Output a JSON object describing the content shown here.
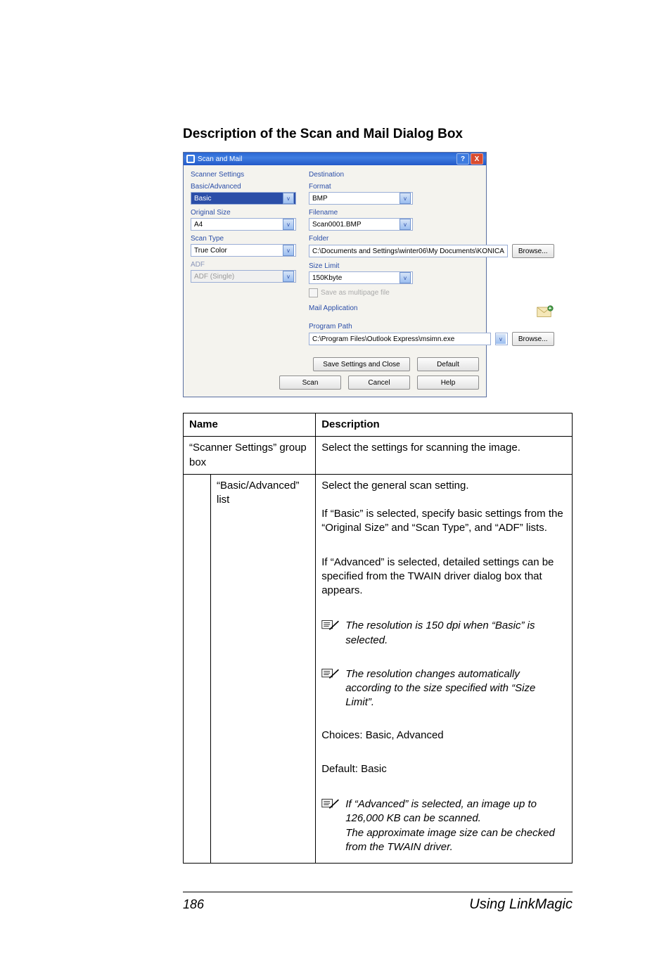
{
  "section_title": "Description of the Scan and Mail Dialog Box",
  "dialog": {
    "title": "Scan and Mail",
    "help_glyph": "?",
    "close_glyph": "X",
    "scanner_settings_title": "Scanner Settings",
    "basic_advanced_label": "Basic/Advanced",
    "basic_advanced_value": "Basic",
    "original_size_label": "Original Size",
    "original_size_value": "A4",
    "scan_type_label": "Scan Type",
    "scan_type_value": "True Color",
    "adf_label": "ADF",
    "adf_value": "ADF (Single)",
    "destination_title": "Destination",
    "format_label": "Format",
    "format_value": "BMP",
    "filename_label": "Filename",
    "filename_value": "Scan0001.BMP",
    "folder_label": "Folder",
    "folder_value": "C:\\Documents and Settings\\winter06\\My Documents\\KONICA",
    "size_limit_label": "Size Limit",
    "size_limit_value": "150Kbyte",
    "save_multipage_label": "Save as multipage file",
    "mail_app_title": "Mail Application",
    "program_path_label": "Program Path",
    "program_path_value": "C:\\Program Files\\Outlook Express\\msimn.exe",
    "browse_label": "Browse...",
    "save_close_label": "Save Settings and Close",
    "default_label": "Default",
    "scan_label": "Scan",
    "cancel_label": "Cancel",
    "help_label": "Help"
  },
  "table": {
    "header_name": "Name",
    "header_desc": "Description",
    "row1_name": "“Scanner Settings” group box",
    "row1_desc": "Select the settings for scanning the image.",
    "row2_name": "“Basic/Advanced” list",
    "row2_p1": "Select the general scan setting.",
    "row2_p2": "If “Basic” is selected, specify basic settings from the “Original Size” and “Scan Type”, and “ADF” lists.",
    "row2_p3": "If “Advanced” is selected, detailed settings can be specified from the TWAIN driver dialog box that appears.",
    "row2_note1": "The resolution is 150 dpi when “Basic” is selected.",
    "row2_note2": "The resolution changes automatically according to the size specified with “Size Limit”.",
    "row2_p4": "Choices: Basic, Advanced",
    "row2_p5": "Default: Basic",
    "row2_note3": "If “Advanced” is selected, an image up to 126,000 KB can be scanned.\nThe approximate image size can be checked from the TWAIN driver."
  },
  "footer": {
    "page_number": "186",
    "page_text": "Using LinkMagic"
  }
}
